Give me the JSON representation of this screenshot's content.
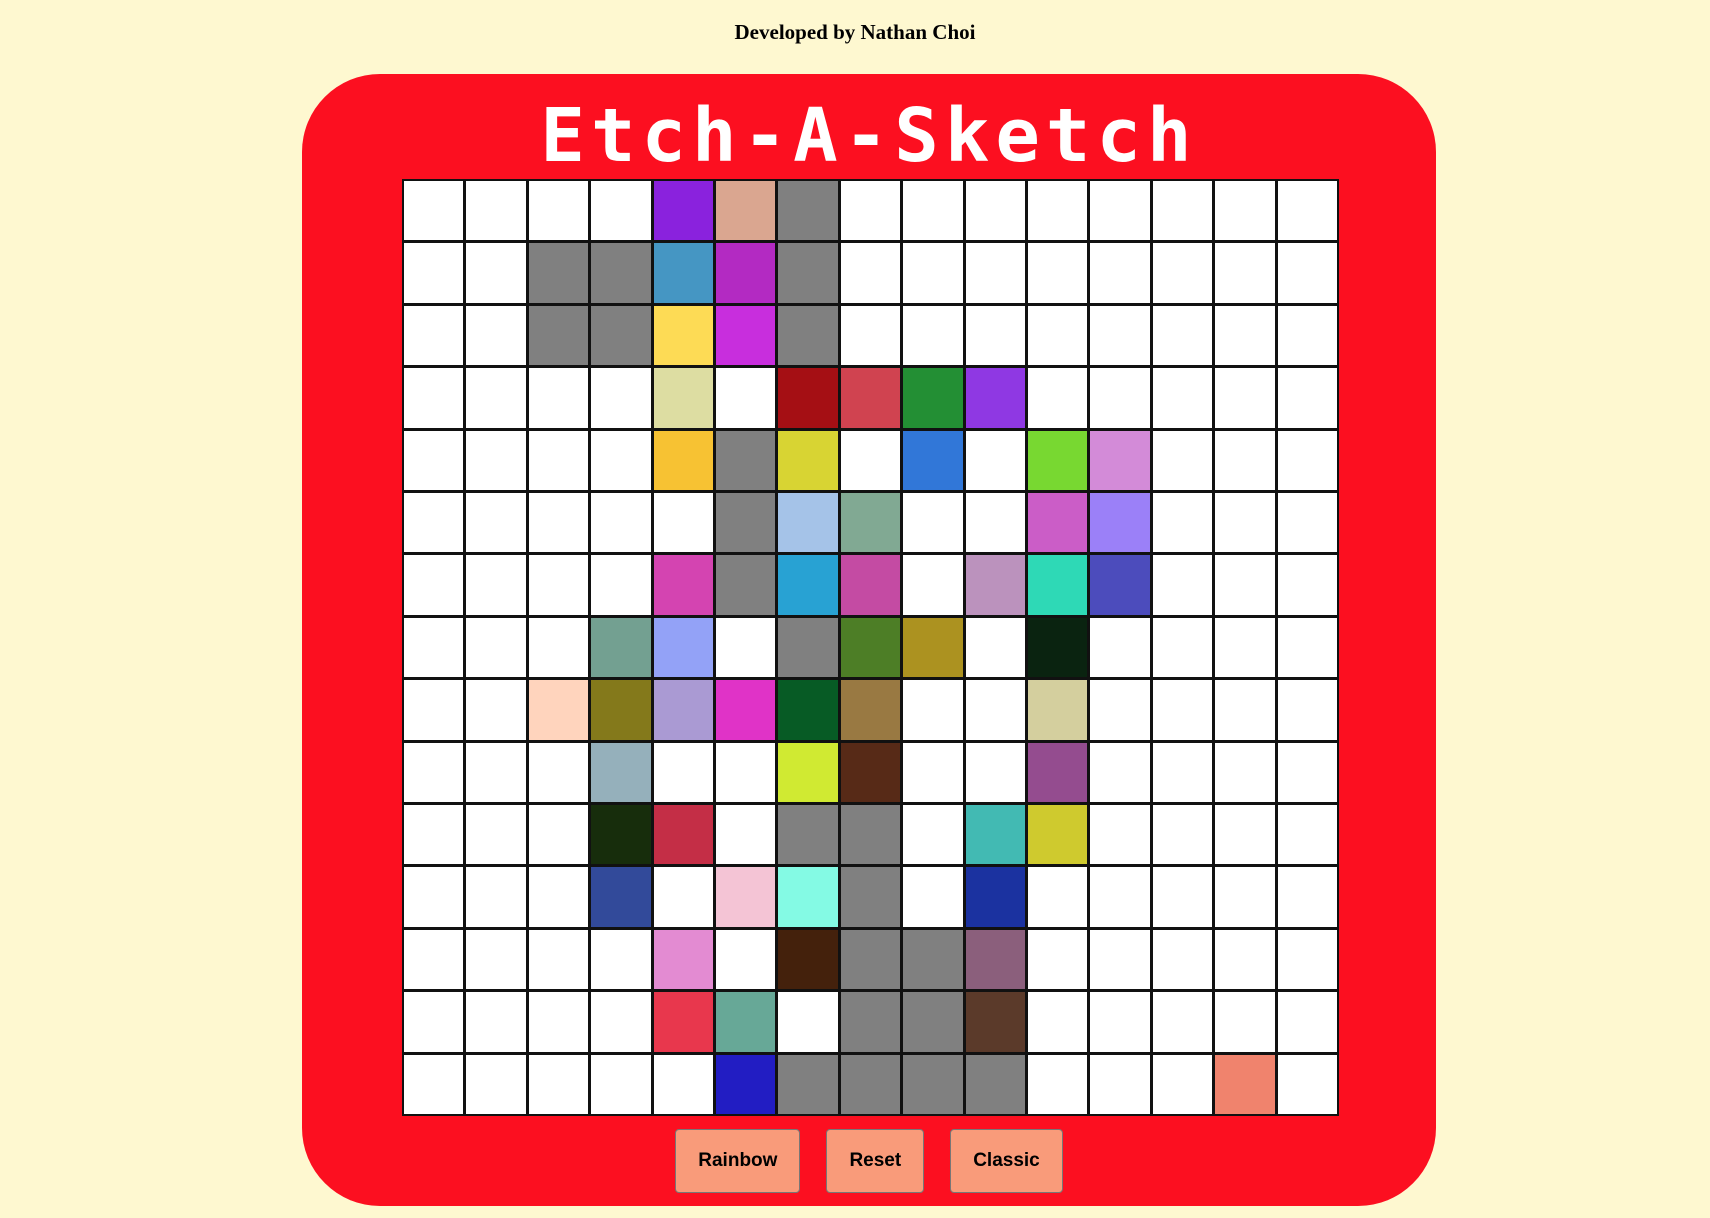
{
  "credit": "Developed by Nathan Choi",
  "title": "Etch-A-Sketch",
  "buttons": {
    "rainbow": "Rainbow",
    "reset": "Reset",
    "classic": "Classic"
  },
  "grid": {
    "size": 15,
    "rows": [
      [
        "#ffffff",
        "#ffffff",
        "#ffffff",
        "#ffffff",
        "#8a22dd",
        "#daa690",
        "#808080",
        "#ffffff",
        "#ffffff",
        "#ffffff",
        "#ffffff",
        "#ffffff",
        "#ffffff",
        "#ffffff",
        "#ffffff"
      ],
      [
        "#ffffff",
        "#ffffff",
        "#808080",
        "#808080",
        "#4596c3",
        "#b32ac2",
        "#808080",
        "#ffffff",
        "#ffffff",
        "#ffffff",
        "#ffffff",
        "#ffffff",
        "#ffffff",
        "#ffffff",
        "#ffffff"
      ],
      [
        "#ffffff",
        "#ffffff",
        "#808080",
        "#808080",
        "#fddb55",
        "#c82edd",
        "#808080",
        "#ffffff",
        "#ffffff",
        "#ffffff",
        "#ffffff",
        "#ffffff",
        "#ffffff",
        "#ffffff",
        "#ffffff"
      ],
      [
        "#ffffff",
        "#ffffff",
        "#ffffff",
        "#ffffff",
        "#dddda2",
        "#ffffff",
        "#a50f14",
        "#d04350",
        "#238f34",
        "#8f38e3",
        "#ffffff",
        "#ffffff",
        "#ffffff",
        "#ffffff",
        "#ffffff"
      ],
      [
        "#ffffff",
        "#ffffff",
        "#ffffff",
        "#ffffff",
        "#f7c233",
        "#808080",
        "#d8d433",
        "#ffffff",
        "#3177d8",
        "#ffffff",
        "#78d831",
        "#d38bd8",
        "#ffffff",
        "#ffffff",
        "#ffffff"
      ],
      [
        "#ffffff",
        "#ffffff",
        "#ffffff",
        "#ffffff",
        "#ffffff",
        "#808080",
        "#a5c3e8",
        "#81a993",
        "#ffffff",
        "#ffffff",
        "#cb5dc7",
        "#9b80f8",
        "#ffffff",
        "#ffffff",
        "#ffffff"
      ],
      [
        "#ffffff",
        "#ffffff",
        "#ffffff",
        "#ffffff",
        "#d444b1",
        "#808080",
        "#28a2d3",
        "#c44ba3",
        "#ffffff",
        "#bb92bd",
        "#2ed9b6",
        "#4c4cbc",
        "#ffffff",
        "#ffffff",
        "#ffffff"
      ],
      [
        "#ffffff",
        "#ffffff",
        "#ffffff",
        "#73a091",
        "#93a2f7",
        "#ffffff",
        "#808080",
        "#4d7e26",
        "#ac9220",
        "#ffffff",
        "#0a2310",
        "#ffffff",
        "#ffffff",
        "#ffffff",
        "#ffffff"
      ],
      [
        "#ffffff",
        "#ffffff",
        "#ffd4bd",
        "#84791b",
        "#aa9ad3",
        "#e033c7",
        "#075b25",
        "#997942",
        "#ffffff",
        "#ffffff",
        "#d4cf9e",
        "#ffffff",
        "#ffffff",
        "#ffffff",
        "#ffffff"
      ],
      [
        "#ffffff",
        "#ffffff",
        "#ffffff",
        "#95b0bb",
        "#ffffff",
        "#ffffff",
        "#d0ea32",
        "#572a17",
        "#ffffff",
        "#ffffff",
        "#944c8f",
        "#ffffff",
        "#ffffff",
        "#ffffff",
        "#ffffff"
      ],
      [
        "#ffffff",
        "#ffffff",
        "#ffffff",
        "#172d0c",
        "#c42e46",
        "#ffffff",
        "#808080",
        "#808080",
        "#ffffff",
        "#42bab3",
        "#cfca2e",
        "#ffffff",
        "#ffffff",
        "#ffffff",
        "#ffffff"
      ],
      [
        "#ffffff",
        "#ffffff",
        "#ffffff",
        "#324a9a",
        "#ffffff",
        "#f4c4d5",
        "#84fae4",
        "#808080",
        "#ffffff",
        "#1b32a0",
        "#ffffff",
        "#ffffff",
        "#ffffff",
        "#ffffff",
        "#ffffff"
      ],
      [
        "#ffffff",
        "#ffffff",
        "#ffffff",
        "#ffffff",
        "#e38bd2",
        "#ffffff",
        "#44210c",
        "#808080",
        "#808080",
        "#8b5f7c",
        "#ffffff",
        "#ffffff",
        "#ffffff",
        "#ffffff",
        "#ffffff"
      ],
      [
        "#ffffff",
        "#ffffff",
        "#ffffff",
        "#ffffff",
        "#e8374d",
        "#67a897",
        "#ffffff",
        "#808080",
        "#808080",
        "#5b3a2a",
        "#ffffff",
        "#ffffff",
        "#ffffff",
        "#ffffff",
        "#ffffff"
      ],
      [
        "#ffffff",
        "#ffffff",
        "#ffffff",
        "#ffffff",
        "#ffffff",
        "#221dc3",
        "#808080",
        "#808080",
        "#808080",
        "#808080",
        "#ffffff",
        "#ffffff",
        "#ffffff",
        "#f0836d",
        "#ffffff"
      ]
    ]
  },
  "colors": {
    "background": "#fef8d0",
    "frame": "#fc0f20",
    "button": "#f99b7a"
  }
}
